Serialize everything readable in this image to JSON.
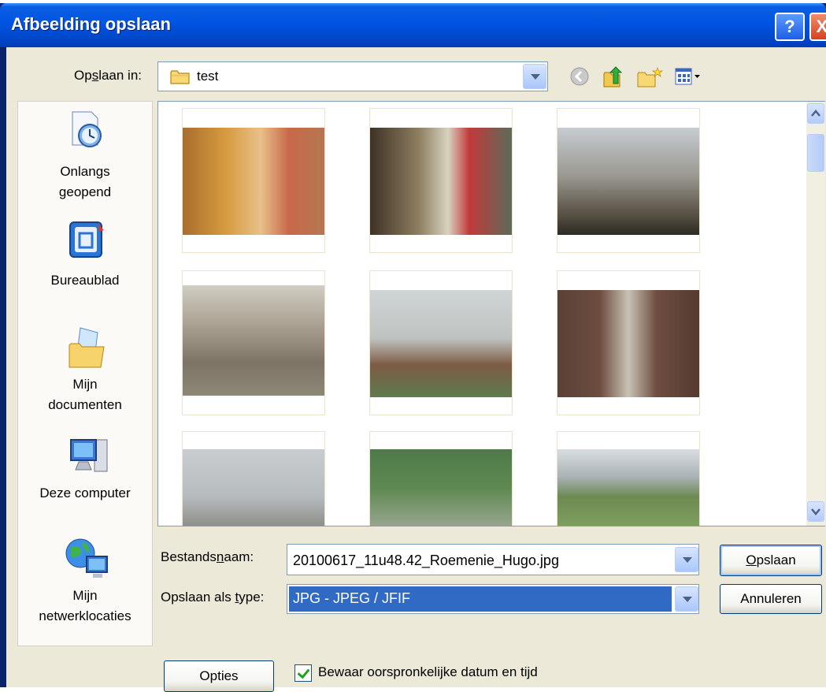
{
  "window": {
    "title": "Afbeelding opslaan",
    "help_label": "?",
    "close_label": "X"
  },
  "lookin": {
    "label_pre": "Op",
    "label_accel": "s",
    "label_post": "laan in:",
    "value": "test"
  },
  "places": [
    {
      "label_line1": "Onlangs",
      "label_line2": "geopend",
      "icon": "recent-documents-icon"
    },
    {
      "label_line1": "Bureaublad",
      "label_line2": "",
      "icon": "desktop-icon"
    },
    {
      "label_line1": "Mijn",
      "label_line2": "documenten",
      "icon": "my-documents-icon"
    },
    {
      "label_line1": "Deze computer",
      "label_line2": "",
      "icon": "my-computer-icon"
    },
    {
      "label_line1": "Mijn",
      "label_line2": "netwerklocaties",
      "icon": "network-places-icon"
    }
  ],
  "filename": {
    "label_pre": "Bestands",
    "label_accel": "n",
    "label_post": "aam:",
    "value": "20100617_11u48.42_Roemenie_Hugo.jpg"
  },
  "filetype": {
    "label_pre": "Opslaan als ",
    "label_accel": "t",
    "label_post": "ype:",
    "value": "JPG - JPEG / JFIF"
  },
  "buttons": {
    "save_accel": "O",
    "save_rest": "pslaan",
    "cancel": "Annuleren",
    "options": "Opties"
  },
  "keep_datetime": {
    "label": "Bewaar oorspronkelijke datum en tijd",
    "checked": true
  },
  "colors": {
    "titlebar": "#0054e3",
    "dialog_bg": "#ece9d8",
    "selection": "#316ac5"
  }
}
